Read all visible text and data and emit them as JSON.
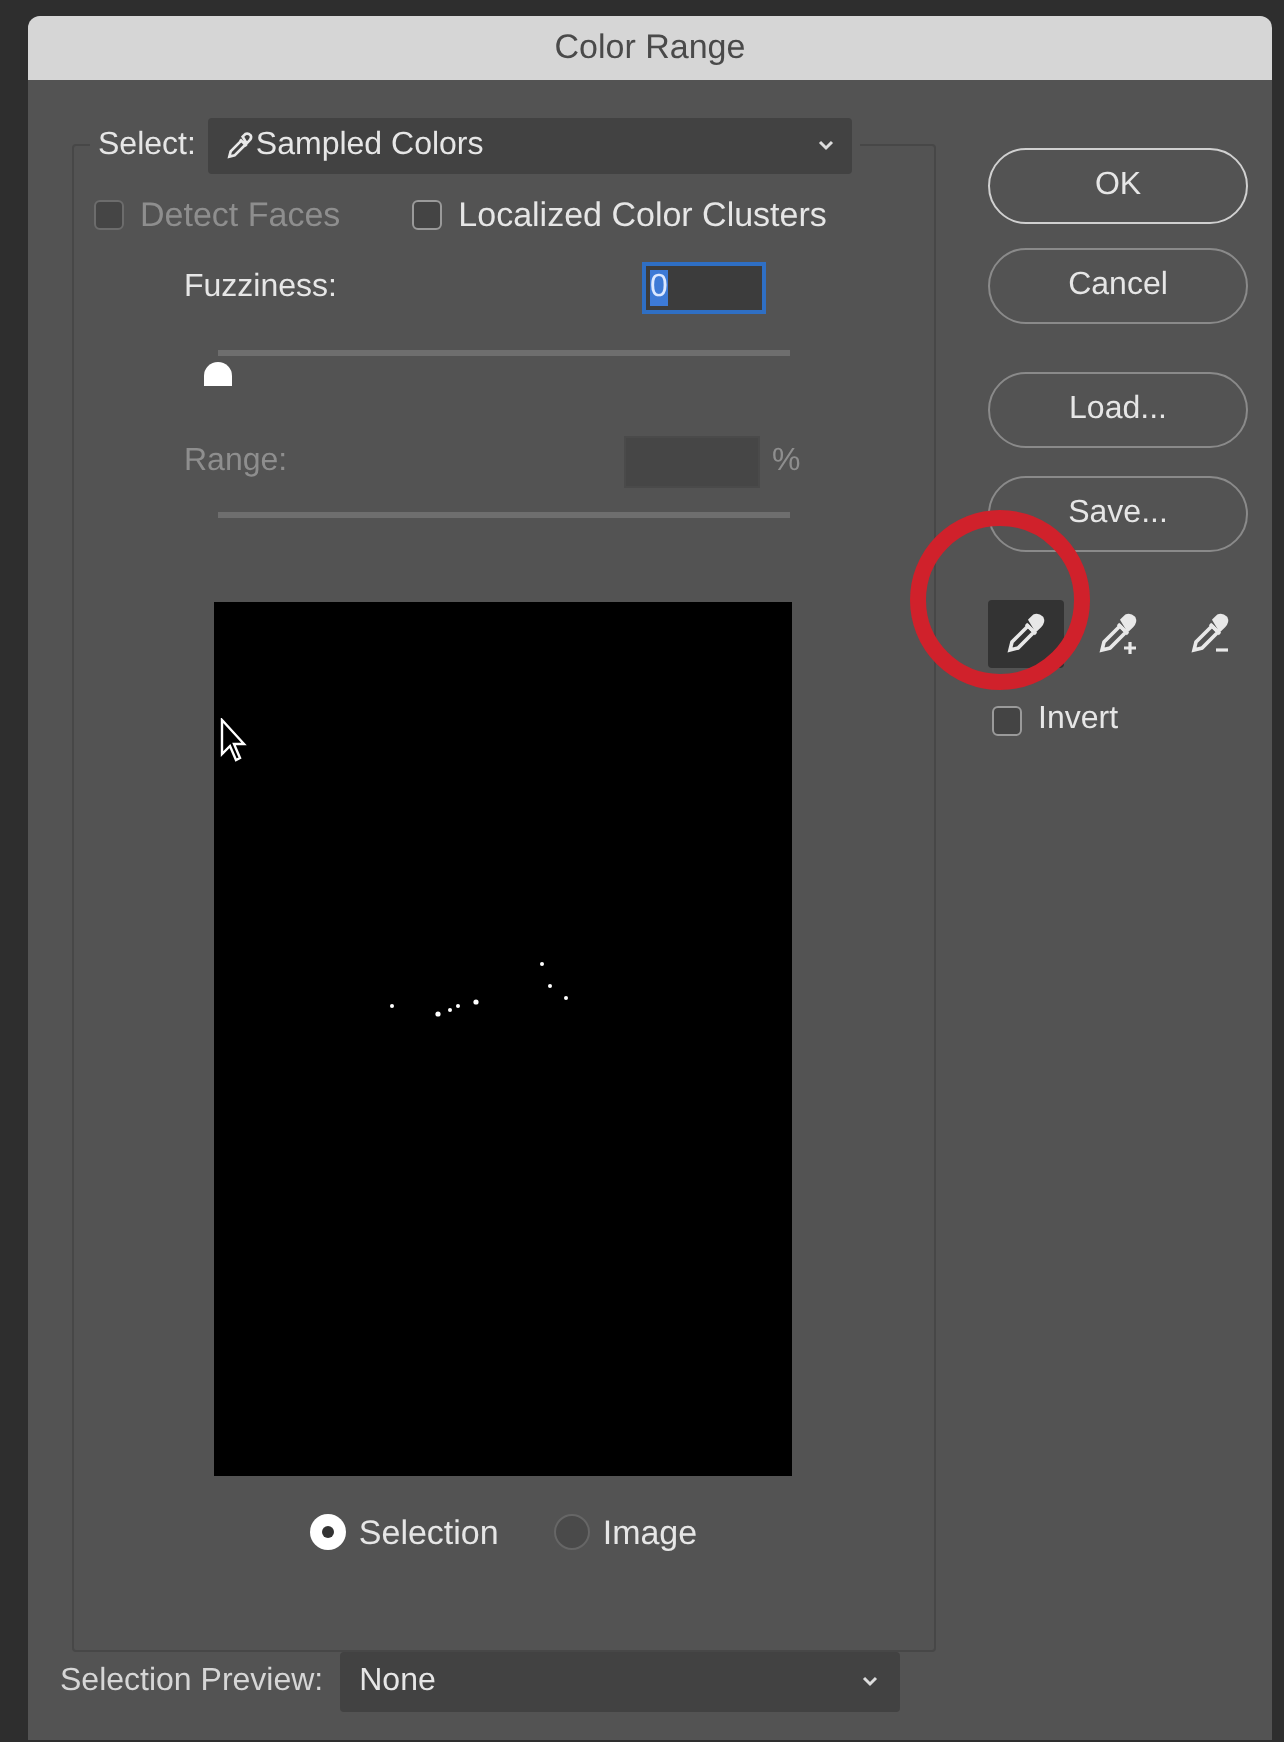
{
  "window": {
    "title": "Color Range"
  },
  "select": {
    "label": "Select:",
    "value": "Sampled Colors"
  },
  "options": [
    {
      "label": "Detect Faces",
      "checked": false,
      "disabled": true
    },
    {
      "label": "Localized Color Clusters",
      "checked": false,
      "disabled": false
    }
  ],
  "fuzziness": {
    "label": "Fuzziness:",
    "value": "0",
    "level": 0,
    "disabled": false
  },
  "range": {
    "label": "Range:",
    "unit": "%",
    "disabled": true
  },
  "preview_mode": [
    {
      "label": "Selection",
      "selected": true
    },
    {
      "label": "Image",
      "selected": false
    }
  ],
  "selection_preview": {
    "label": "Selection Preview:",
    "value": "None"
  },
  "buttons": [
    "OK",
    "Cancel",
    "Load...",
    "Save..."
  ],
  "eyedroppers": [
    {
      "kind": "plain",
      "selected": true
    },
    {
      "kind": "add",
      "selected": false
    },
    {
      "kind": "subtract",
      "selected": false
    }
  ],
  "invert": {
    "label": "Invert",
    "checked": false
  }
}
